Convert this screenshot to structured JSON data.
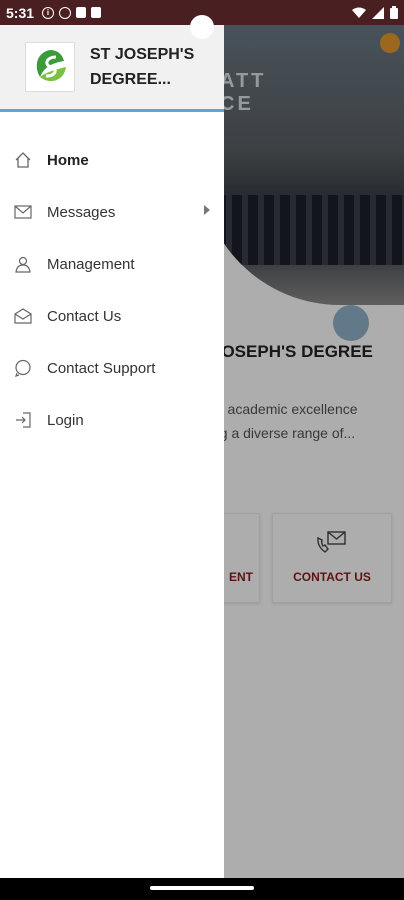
{
  "status_bar": {
    "time": "5:31",
    "left_icons": [
      "info-icon",
      "shield-icon",
      "notification-icon",
      "sd-card-icon"
    ],
    "right_icons": [
      "wifi-icon",
      "signal-icon",
      "battery-icon"
    ]
  },
  "drawer": {
    "org_name": "ST JOSEPH'S DEGREE...",
    "items": [
      {
        "label": "Home",
        "icon": "home-icon",
        "active": true
      },
      {
        "label": "Messages",
        "icon": "mail-icon",
        "has_submenu": true
      },
      {
        "label": "Management",
        "icon": "management-icon"
      },
      {
        "label": "Contact Us",
        "icon": "contact-mail-icon"
      },
      {
        "label": "Contact Support",
        "icon": "whatsapp-icon"
      },
      {
        "label": "Login",
        "icon": "login-icon"
      }
    ]
  },
  "background": {
    "photo_sign": "ATT\nCE",
    "title_line1": "JOSEPH'S DEGREE",
    "title_line2": ")!",
    "desc_line1": "rs academic excellence",
    "desc_line2": "ng a diverse range of...",
    "card1_label": "ENT",
    "card2_label": "CONTACT US"
  },
  "colors": {
    "status_bar": "#4a1f22",
    "header_divider": "#5aa5dc",
    "accent_red": "#8c1b1b",
    "orange_dot": "#e69a2b"
  }
}
